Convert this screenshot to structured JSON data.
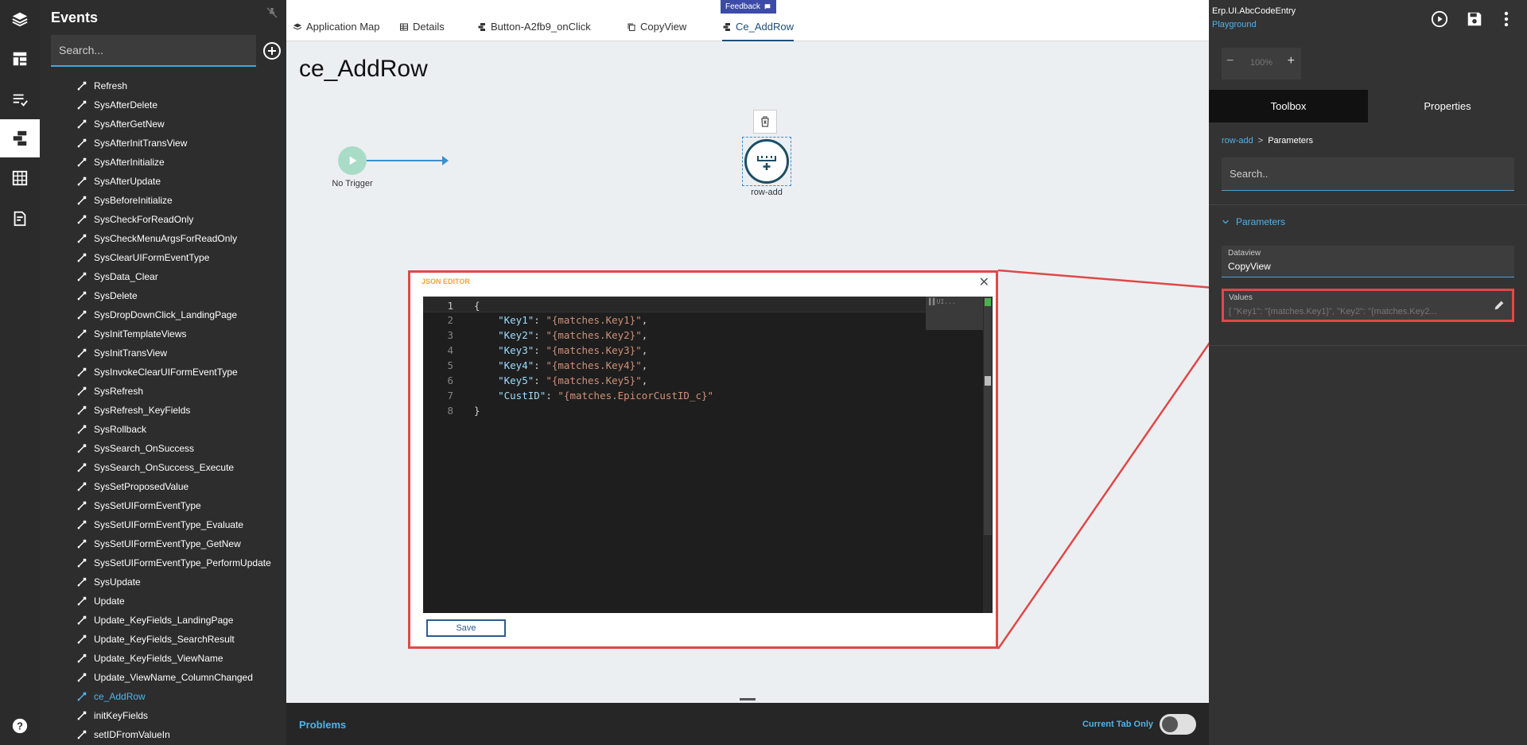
{
  "events_panel": {
    "title": "Events",
    "search_placeholder": "Search...",
    "items": [
      {
        "label": "Refresh"
      },
      {
        "label": "SysAfterDelete"
      },
      {
        "label": "SysAfterGetNew"
      },
      {
        "label": "SysAfterInitTransView"
      },
      {
        "label": "SysAfterInitialize"
      },
      {
        "label": "SysAfterUpdate"
      },
      {
        "label": "SysBeforeInitialize"
      },
      {
        "label": "SysCheckForReadOnly"
      },
      {
        "label": "SysCheckMenuArgsForReadOnly"
      },
      {
        "label": "SysClearUIFormEventType"
      },
      {
        "label": "SysData_Clear"
      },
      {
        "label": "SysDelete"
      },
      {
        "label": "SysDropDownClick_LandingPage"
      },
      {
        "label": "SysInitTemplateViews"
      },
      {
        "label": "SysInitTransView"
      },
      {
        "label": "SysInvokeClearUIFormEventType"
      },
      {
        "label": "SysRefresh"
      },
      {
        "label": "SysRefresh_KeyFields"
      },
      {
        "label": "SysRollback"
      },
      {
        "label": "SysSearch_OnSuccess"
      },
      {
        "label": "SysSearch_OnSuccess_Execute"
      },
      {
        "label": "SysSetProposedValue"
      },
      {
        "label": "SysSetUIFormEventType"
      },
      {
        "label": "SysSetUIFormEventType_Evaluate"
      },
      {
        "label": "SysSetUIFormEventType_GetNew"
      },
      {
        "label": "SysSetUIFormEventType_PerformUpdate"
      },
      {
        "label": "SysUpdate"
      },
      {
        "label": "Update"
      },
      {
        "label": "Update_KeyFields_LandingPage"
      },
      {
        "label": "Update_KeyFields_SearchResult"
      },
      {
        "label": "Update_KeyFields_ViewName"
      },
      {
        "label": "Update_ViewName_ColumnChanged"
      },
      {
        "label": "ce_AddRow",
        "selected": true
      },
      {
        "label": "initKeyFields"
      },
      {
        "label": "setIDFromValueIn"
      }
    ]
  },
  "tabs": [
    {
      "label": "Application Map",
      "icon": "layers-icon"
    },
    {
      "label": "Details",
      "icon": "table-icon"
    },
    {
      "label": "Button-A2fb9_onClick",
      "icon": "event-icon"
    },
    {
      "label": "CopyView",
      "icon": "copy-icon"
    },
    {
      "label": "Ce_AddRow",
      "icon": "event-icon",
      "active": true
    }
  ],
  "feedback_label": "Feedback",
  "page_title": "ce_AddRow",
  "flow": {
    "trigger_label": "No Trigger",
    "action_label": "row-add"
  },
  "json_editor": {
    "title": "JSON EDITOR",
    "save_label": "Save",
    "minimap_text": "▌▌UI...",
    "lines": [
      {
        "n": "1",
        "parts": [
          {
            "t": "{",
            "c": ""
          }
        ]
      },
      {
        "n": "2",
        "parts": [
          {
            "t": "    ",
            "c": ""
          },
          {
            "t": "\"Key1\"",
            "c": "k"
          },
          {
            "t": ": ",
            "c": ""
          },
          {
            "t": "\"{matches.Key1}\"",
            "c": "s"
          },
          {
            "t": ",",
            "c": ""
          }
        ]
      },
      {
        "n": "3",
        "parts": [
          {
            "t": "    ",
            "c": ""
          },
          {
            "t": "\"Key2\"",
            "c": "k"
          },
          {
            "t": ": ",
            "c": ""
          },
          {
            "t": "\"{matches.Key2}\"",
            "c": "s"
          },
          {
            "t": ",",
            "c": ""
          }
        ]
      },
      {
        "n": "4",
        "parts": [
          {
            "t": "    ",
            "c": ""
          },
          {
            "t": "\"Key3\"",
            "c": "k"
          },
          {
            "t": ": ",
            "c": ""
          },
          {
            "t": "\"{matches.Key3}\"",
            "c": "s"
          },
          {
            "t": ",",
            "c": ""
          }
        ]
      },
      {
        "n": "5",
        "parts": [
          {
            "t": "    ",
            "c": ""
          },
          {
            "t": "\"Key4\"",
            "c": "k"
          },
          {
            "t": ": ",
            "c": ""
          },
          {
            "t": "\"{matches.Key4}\"",
            "c": "s"
          },
          {
            "t": ",",
            "c": ""
          }
        ]
      },
      {
        "n": "6",
        "parts": [
          {
            "t": "    ",
            "c": ""
          },
          {
            "t": "\"Key5\"",
            "c": "k"
          },
          {
            "t": ": ",
            "c": ""
          },
          {
            "t": "\"{matches.Key5}\"",
            "c": "s"
          },
          {
            "t": ",",
            "c": ""
          }
        ]
      },
      {
        "n": "7",
        "parts": [
          {
            "t": "    ",
            "c": ""
          },
          {
            "t": "\"CustID\"",
            "c": "k"
          },
          {
            "t": ": ",
            "c": ""
          },
          {
            "t": "\"{matches.EpicorCustID_c}\"",
            "c": "s"
          }
        ]
      },
      {
        "n": "8",
        "parts": [
          {
            "t": "}",
            "c": ""
          }
        ]
      }
    ]
  },
  "problems": {
    "title": "Problems",
    "current_tab_label": "Current Tab Only"
  },
  "right_panel": {
    "app_name": "Erp.UI.AbcCodeEntry",
    "env_label": "Playground",
    "zoom_value": "100%",
    "tab_toolbox": "Toolbox",
    "tab_properties": "Properties",
    "breadcrumb_link": "row-add",
    "breadcrumb_sep": ">",
    "breadcrumb_current": "Parameters",
    "search_placeholder": "Search..",
    "section_title": "Parameters",
    "dataview_label": "Dataview",
    "dataview_value": "CopyView",
    "values_label": "Values",
    "values_value": "[ \"Key1\": \"{matches.Key1}\", \"Key2\": \"{matches.Key2..."
  },
  "colors": {
    "accent": "#4fb3ea",
    "callout": "#e04848",
    "node": "#1d4e63",
    "trigger": "#a9dcc6"
  }
}
